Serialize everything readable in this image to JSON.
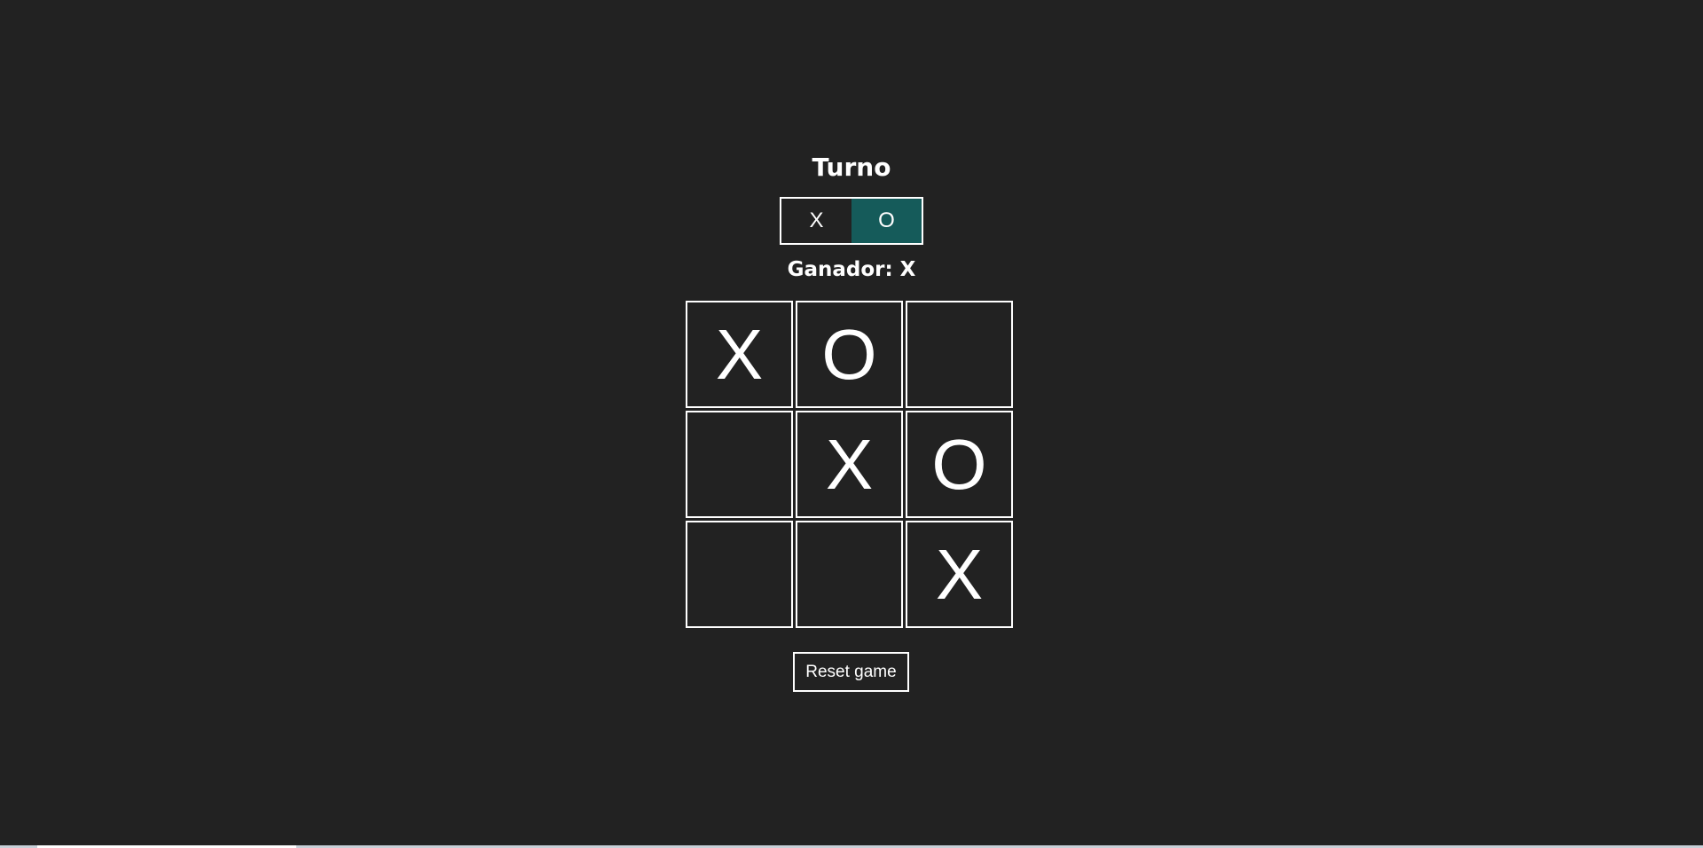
{
  "title": "Turno",
  "turn": {
    "options": [
      "X",
      "O"
    ],
    "active": "O",
    "active_color": "#155b5a"
  },
  "winner_text": "Ganador: X",
  "board": [
    "X",
    "O",
    "",
    "",
    "X",
    "O",
    "",
    "",
    "X"
  ],
  "reset_label": "Reset game"
}
